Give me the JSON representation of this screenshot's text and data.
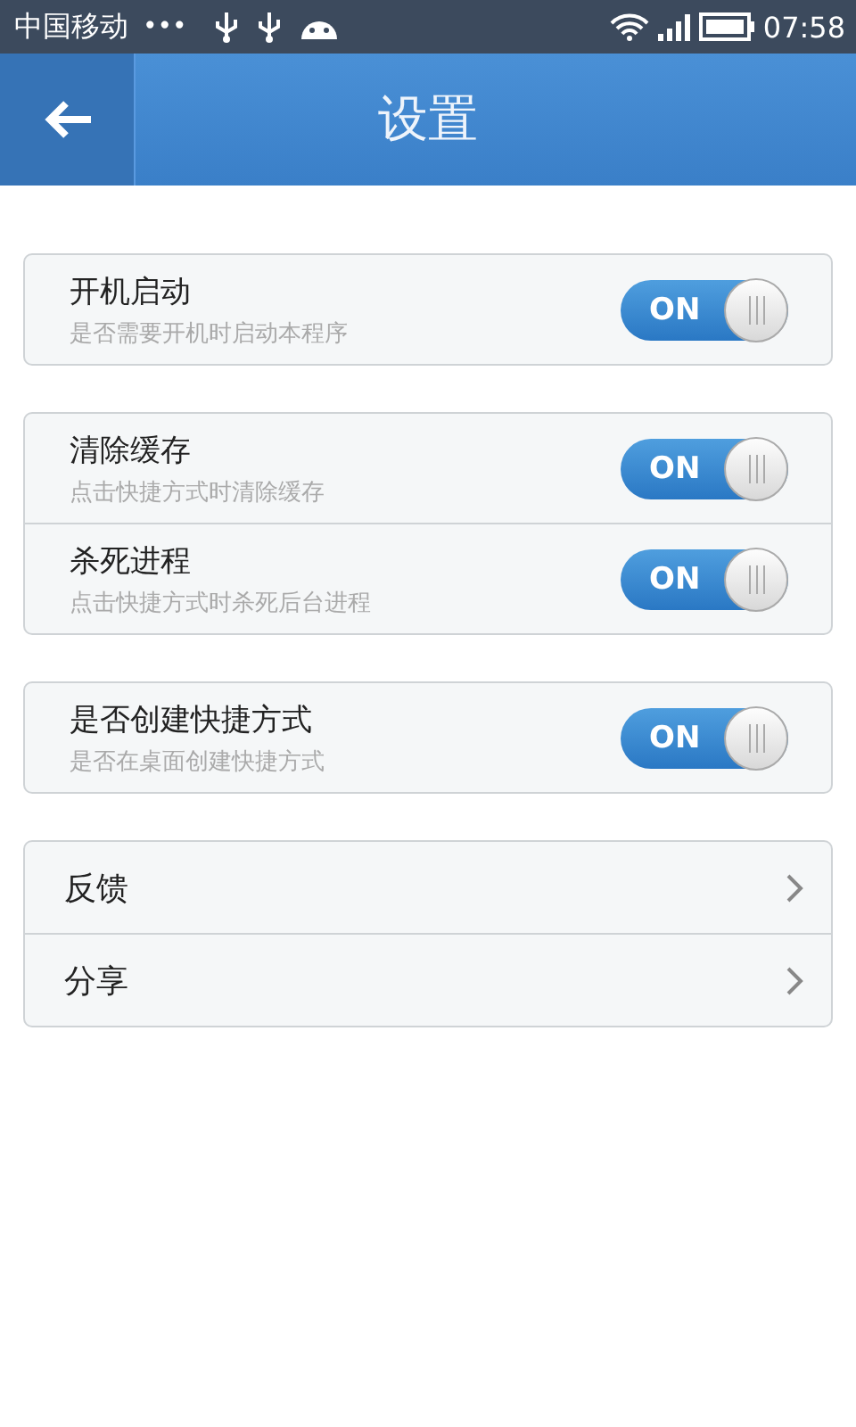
{
  "status_bar": {
    "carrier": "中国移动",
    "dots": "•••",
    "time": "07:58"
  },
  "header": {
    "title": "设置"
  },
  "groups": [
    {
      "items": [
        {
          "kind": "toggle",
          "title": "开机启动",
          "subtitle": "是否需要开机时启动本程序",
          "on": true,
          "switch_label": "ON"
        }
      ]
    },
    {
      "items": [
        {
          "kind": "toggle",
          "title": "清除缓存",
          "subtitle": "点击快捷方式时清除缓存",
          "on": true,
          "switch_label": "ON"
        },
        {
          "kind": "toggle",
          "title": "杀死进程",
          "subtitle": "点击快捷方式时杀死后台进程",
          "on": true,
          "switch_label": "ON"
        }
      ]
    },
    {
      "items": [
        {
          "kind": "toggle",
          "title": "是否创建快捷方式",
          "subtitle": "是否在桌面创建快捷方式",
          "on": true,
          "switch_label": "ON"
        }
      ]
    },
    {
      "items": [
        {
          "kind": "link",
          "title": "反馈"
        },
        {
          "kind": "link",
          "title": "分享"
        }
      ]
    }
  ]
}
